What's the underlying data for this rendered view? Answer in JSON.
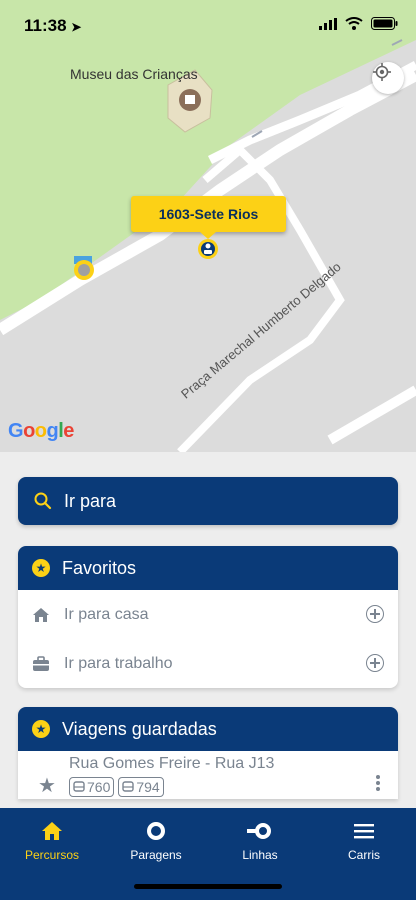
{
  "status_bar": {
    "time": "11:38"
  },
  "map": {
    "poi_label": "Museu das Crianças",
    "street_label": "Praça Marechal Humberto Delgado",
    "stop_callout": "1603-Sete Rios",
    "attribution": [
      "G",
      "o",
      "o",
      "g",
      "l",
      "e"
    ]
  },
  "search": {
    "label": "Ir para"
  },
  "favorites": {
    "title": "Favoritos",
    "items": [
      {
        "label": "Ir para casa"
      },
      {
        "label": "Ir para trabalho"
      }
    ]
  },
  "saved_trips": {
    "title": "Viagens guardadas",
    "items": [
      {
        "title": "Rua Gomes Freire - Rua J13",
        "lines": [
          "760",
          "794"
        ]
      }
    ]
  },
  "bottom_nav": {
    "items": [
      {
        "label": "Percursos",
        "icon": "home-icon"
      },
      {
        "label": "Paragens",
        "icon": "stop-circle-icon"
      },
      {
        "label": "Linhas",
        "icon": "lines-icon"
      },
      {
        "label": "Carris",
        "icon": "menu-icon"
      }
    ]
  },
  "colors": {
    "primary": "#0a3a78",
    "accent": "#fcd116",
    "map_green": "#c7e6a8",
    "map_gray": "#dcdcdc"
  }
}
